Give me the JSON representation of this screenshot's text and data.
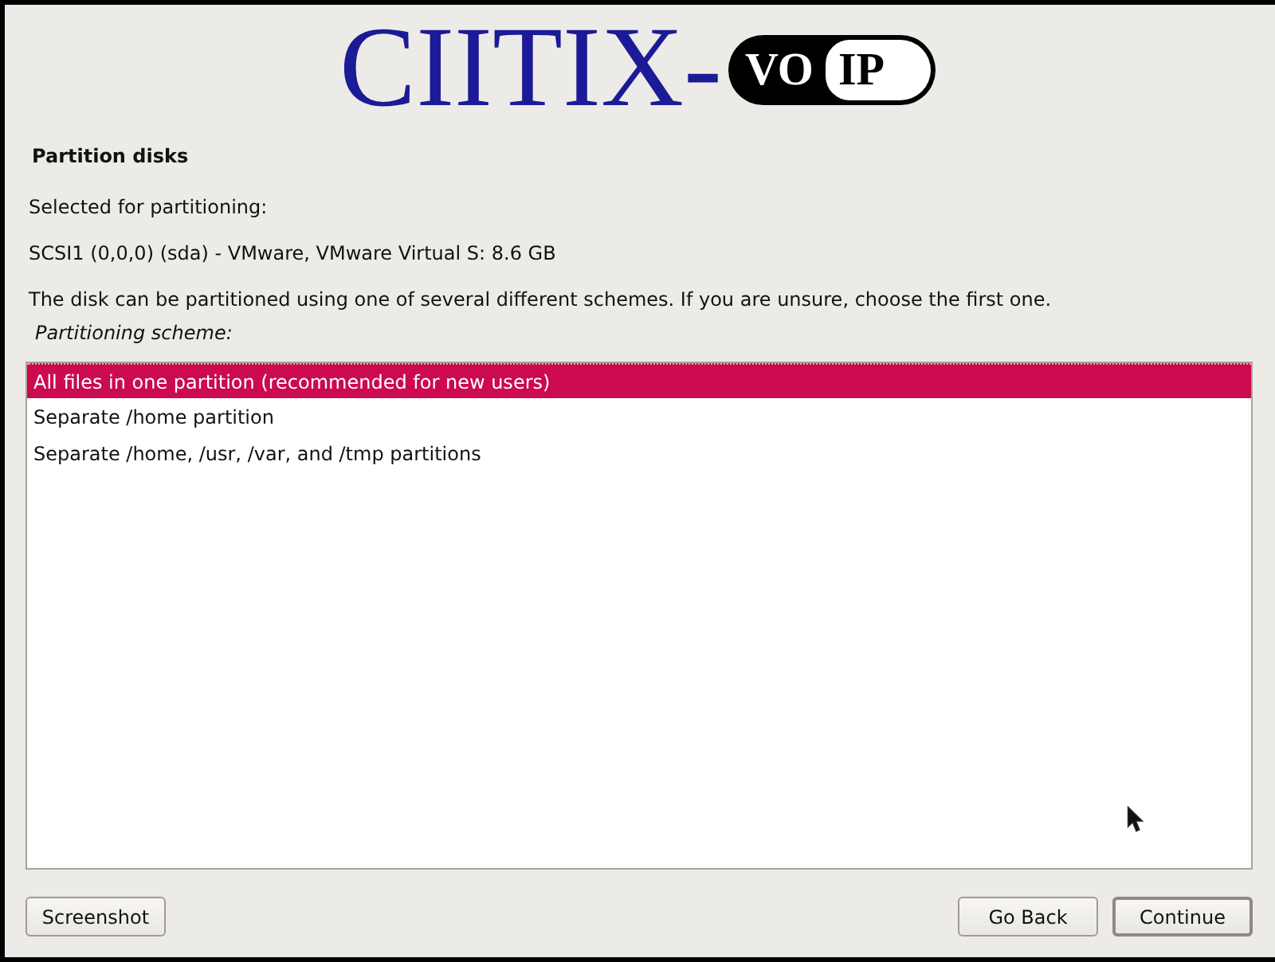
{
  "logo": {
    "text": "CIITIX-",
    "badge_left": "VO",
    "badge_right": "IP"
  },
  "title": "Partition disks",
  "paragraphs": [
    "Selected for partitioning:",
    "SCSI1 (0,0,0) (sda) - VMware, VMware Virtual S: 8.6 GB",
    "The disk can be partitioned using one of several different schemes. If you are unsure, choose the first one."
  ],
  "list": {
    "label": "Partitioning scheme:",
    "items": [
      {
        "label": "All files in one partition (recommended for new users)",
        "selected": true
      },
      {
        "label": "Separate /home partition",
        "selected": false
      },
      {
        "label": "Separate /home, /usr, /var, and /tmp partitions",
        "selected": false
      }
    ]
  },
  "buttons": [
    {
      "label": "Screenshot",
      "default": false
    },
    {
      "label": "Go Back",
      "default": false
    },
    {
      "label": "Continue",
      "default": true
    }
  ]
}
